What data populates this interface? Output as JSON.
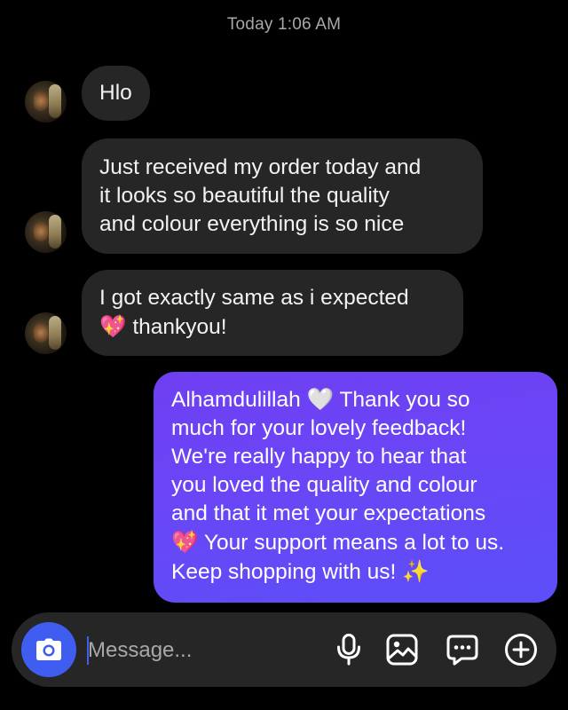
{
  "timestamp": "Today 1:06 AM",
  "messages": [
    {
      "direction": "incoming",
      "lines": [
        "Hlo"
      ]
    },
    {
      "direction": "incoming",
      "lines": [
        "Just received my order today and",
        "it looks so beautiful the quality",
        "and colour everything is so nice"
      ]
    },
    {
      "direction": "incoming",
      "lines": [
        "I got exactly same as i expected"
      ],
      "line2_emoji": "💖",
      "line2_text": "thankyou!"
    },
    {
      "direction": "outgoing",
      "line1_text": "Alhamdulillah",
      "line1_emoji": "🤍",
      "line1_rest": "Thank you so",
      "lines": [
        "much for your lovely feedback!",
        "We're really happy to hear that",
        "you loved the quality and colour",
        "and that it met your expectations"
      ],
      "line6_emoji": "💖",
      "line6_text": "Your support means a lot to us.",
      "line7_text": "Keep shopping with us!",
      "line7_emoji": "✨"
    }
  ],
  "composer": {
    "placeholder": "Message...",
    "camera_icon": "camera-icon",
    "tools": [
      "microphone-icon",
      "gallery-icon",
      "sticker-icon",
      "plus-icon"
    ]
  },
  "colors": {
    "background": "#000000",
    "incoming_bubble": "#262626",
    "outgoing_gradient_start": "#6f3ff2",
    "outgoing_gradient_end": "#5b4ff8",
    "accent": "#3f5df0"
  }
}
